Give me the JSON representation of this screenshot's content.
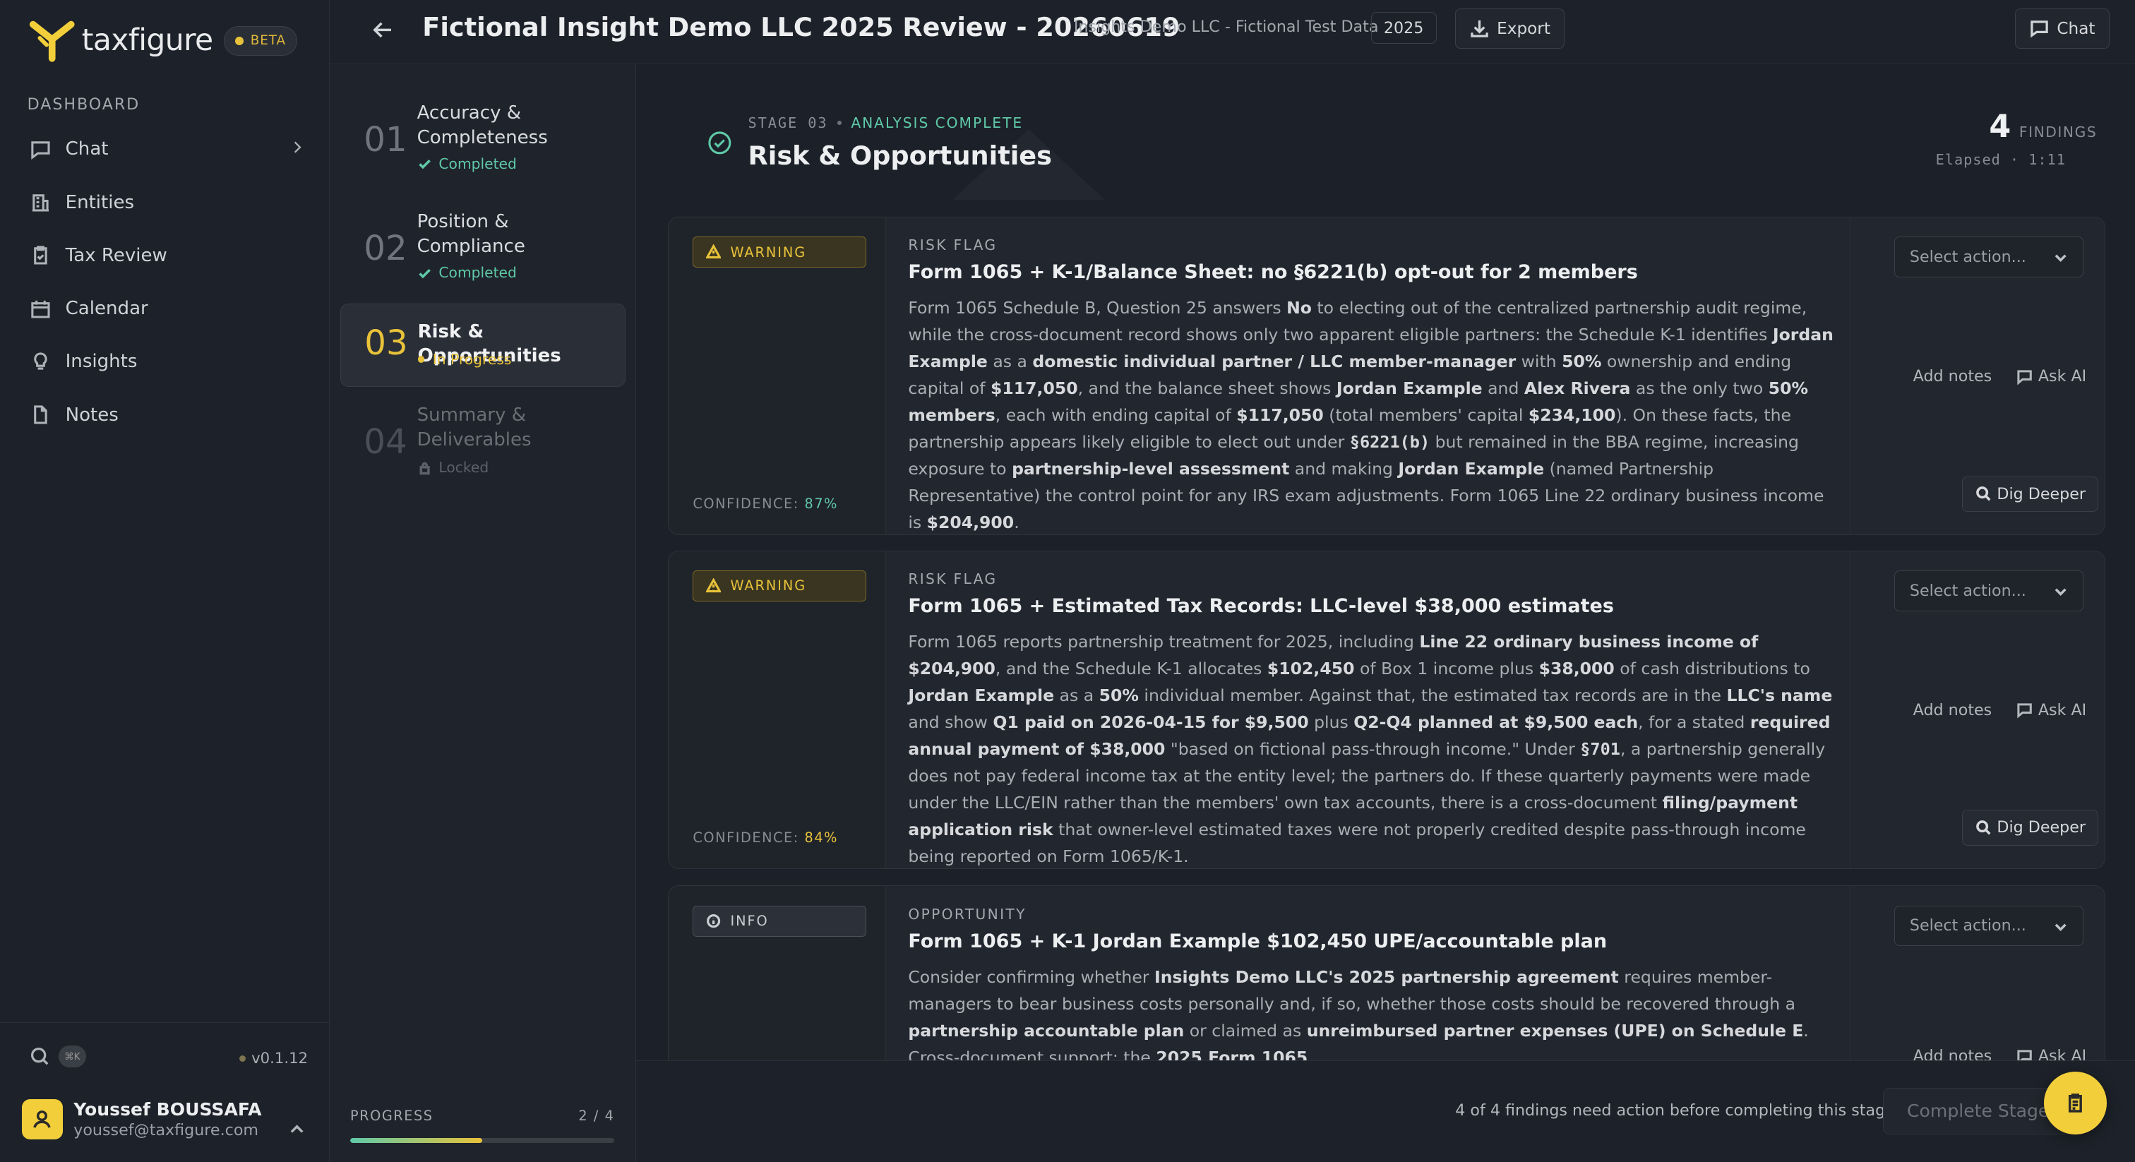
{
  "brand": {
    "name": "taxfigure",
    "badge": "BETA"
  },
  "sidebar": {
    "section": "DASHBOARD",
    "items": [
      {
        "label": "Chat",
        "icon": "chat-icon"
      },
      {
        "label": "Entities",
        "icon": "building-icon"
      },
      {
        "label": "Tax Review",
        "icon": "clipboard-check-icon"
      },
      {
        "label": "Calendar",
        "icon": "calendar-icon"
      },
      {
        "label": "Insights",
        "icon": "lightbulb-icon"
      },
      {
        "label": "Notes",
        "icon": "document-icon"
      }
    ],
    "shortcut": "⌘K",
    "version": "v0.1.12",
    "user": {
      "name": "Youssef BOUSSAFA",
      "email": "youssef@taxfigure.com"
    }
  },
  "header": {
    "title": "Fictional Insight Demo LLC 2025 Review - 20260619",
    "subtitle": "Insights Demo LLC - Fictional Test Data",
    "year": "2025",
    "export_label": "Export",
    "chat_label": "Chat"
  },
  "stages": [
    {
      "num": "01",
      "title": "Accuracy & Completeness",
      "status": "Completed"
    },
    {
      "num": "02",
      "title": "Position & Compliance",
      "status": "Completed"
    },
    {
      "num": "03",
      "title": "Risk & Opportunities",
      "status": "In Progress"
    },
    {
      "num": "04",
      "title": "Summary & Deliverables",
      "status": "Locked"
    }
  ],
  "progress": {
    "label": "PROGRESS",
    "text": "2 / 4",
    "fraction": 0.5
  },
  "section": {
    "stage_label": "STAGE 03",
    "status": "ANALYSIS COMPLETE",
    "title": "Risk & Opportunities",
    "findings_count": "4",
    "findings_label": "FINDINGS",
    "elapsed": "Elapsed · 1:11"
  },
  "cards": [
    {
      "badge": "WARNING",
      "confidence_label": "CONFIDENCE:",
      "confidence": "87%",
      "kind": "RISK FLAG",
      "title": "Form 1065 + K-1/Balance Sheet: no §6221(b) opt-out for 2 members",
      "text": [
        {
          "t": "Form 1065 Schedule B, Question 25 answers "
        },
        {
          "b": "No"
        },
        {
          "t": " to electing out of the centralized partnership audit regime, while the cross-document record shows only two apparent eligible partners: the Schedule K-1 identifies "
        },
        {
          "b": "Jordan Example"
        },
        {
          "t": " as a "
        },
        {
          "b": "domestic individual partner / LLC member-manager"
        },
        {
          "t": " with "
        },
        {
          "b": "50%"
        },
        {
          "t": " ownership and ending capital of "
        },
        {
          "b": "$117,050"
        },
        {
          "t": ", and the balance sheet shows "
        },
        {
          "b": "Jordan Example"
        },
        {
          "t": " and "
        },
        {
          "b": "Alex Rivera"
        },
        {
          "t": " as the only two "
        },
        {
          "b": "50% members"
        },
        {
          "t": ", each with ending capital of "
        },
        {
          "b": "$117,050"
        },
        {
          "t": " (total members' capital "
        },
        {
          "b": "$234,100"
        },
        {
          "t": "). On these facts, the partnership appears likely eligible to elect out under "
        },
        {
          "m": "§6221(b)"
        },
        {
          "t": " but remained in the BBA regime, increasing exposure to "
        },
        {
          "b": "partnership-level assessment"
        },
        {
          "t": " and making "
        },
        {
          "b": "Jordan Example"
        },
        {
          "t": " (named Partnership Representative) the control point for any IRS exam adjustments. Form 1065 Line 22 ordinary business income is "
        },
        {
          "b": "$204,900"
        },
        {
          "t": "."
        }
      ],
      "select_placeholder": "Select action...",
      "add_notes": "Add notes",
      "ask_ai": "Ask AI",
      "dig_deeper": "Dig Deeper"
    },
    {
      "badge": "WARNING",
      "confidence_label": "CONFIDENCE:",
      "confidence": "84%",
      "kind": "RISK FLAG",
      "title": "Form 1065 + Estimated Tax Records: LLC-level $38,000 estimates",
      "text": [
        {
          "t": "Form 1065 reports partnership treatment for 2025, including "
        },
        {
          "b": "Line 22 ordinary business income of $204,900"
        },
        {
          "t": ", and the Schedule K-1 allocates "
        },
        {
          "b": "$102,450"
        },
        {
          "t": " of Box 1 income plus "
        },
        {
          "b": "$38,000"
        },
        {
          "t": " of cash distributions to "
        },
        {
          "b": "Jordan Example"
        },
        {
          "t": " as a "
        },
        {
          "b": "50%"
        },
        {
          "t": " individual member. Against that, the estimated tax records are in the "
        },
        {
          "b": "LLC's name"
        },
        {
          "t": " and show "
        },
        {
          "b": "Q1 paid on 2026-04-15 for $9,500"
        },
        {
          "t": " plus "
        },
        {
          "b": "Q2-Q4 planned at $9,500 each"
        },
        {
          "t": ", for a stated "
        },
        {
          "b": "required annual payment of $38,000"
        },
        {
          "t": " \"based on fictional pass-through income.\" Under "
        },
        {
          "m": "§701"
        },
        {
          "t": ", a partnership generally does not pay federal income tax at the entity level; the partners do. If these quarterly payments were made under the LLC/EIN rather than the members' own tax accounts, there is a cross-document "
        },
        {
          "b": "filing/payment application risk"
        },
        {
          "t": " that owner-level estimated taxes were not properly credited despite pass-through income being reported on Form 1065/K-1."
        }
      ],
      "select_placeholder": "Select action...",
      "add_notes": "Add notes",
      "ask_ai": "Ask AI",
      "dig_deeper": "Dig Deeper"
    },
    {
      "badge": "INFO",
      "kind": "OPPORTUNITY",
      "title": "Form 1065 + K-1 Jordan Example $102,450 UPE/accountable plan",
      "text": [
        {
          "t": "Consider confirming whether "
        },
        {
          "b": "Insights Demo LLC's 2025 partnership agreement"
        },
        {
          "t": " requires member-managers to bear business costs personally and, if so, whether those costs should be recovered through a "
        },
        {
          "b": "partnership accountable plan"
        },
        {
          "t": " or claimed as "
        },
        {
          "b": "unreimbursed partner expenses (UPE) on Schedule E"
        },
        {
          "t": ". Cross-document support: the "
        },
        {
          "b": "2025 Form 1065"
        }
      ],
      "select_placeholder": "Select action...",
      "add_notes": "Add notes",
      "ask_ai": "Ask AI"
    }
  ],
  "footer": {
    "note": "4 of 4 findings need action before completing this stage",
    "complete_label": "Complete Stage"
  },
  "colors": {
    "accent": "#e8c23a",
    "success": "#5fc9a8",
    "background": "#1c2028"
  }
}
